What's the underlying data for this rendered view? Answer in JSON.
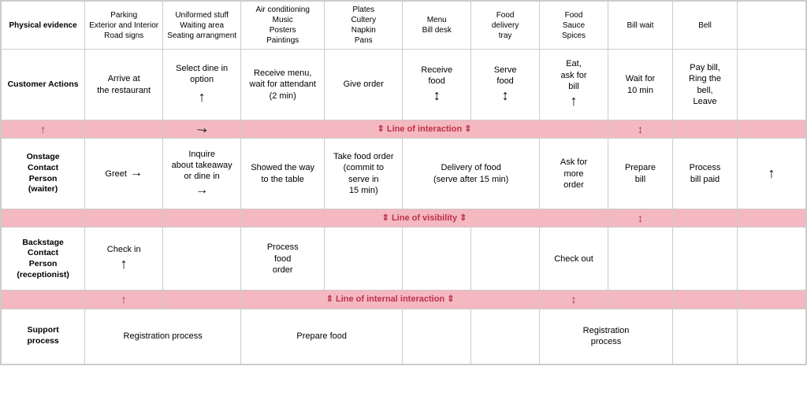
{
  "header": {
    "col0": "Physical evidence",
    "col1": "Parking\nExterior and Interior\nRoad signs",
    "col2": "Uniformed stuff\nWaiting area\nSeating arrangment",
    "col3": "Air conditioning\nMusic\nPosters\nPaintings",
    "col4": "Plates\nCultery\nNapkin\nPans",
    "col5": "Menu\nBill desk",
    "col6": "Food\ndelivery\ntray",
    "col7": "Food\nSauce\nSpices",
    "col8": "Bill wait",
    "col9": "Bell"
  },
  "customer": {
    "label": "Customer Actions",
    "col1": "Arrive at\nthe restaurant",
    "col2": "Select dine in\noption",
    "col3": "Receive menu,\nwait for attendant\n(2 min)",
    "col4": "Give order",
    "col5": "Receive\nfood",
    "col6": "Serve\nfood",
    "col7": "Eat,\nask for\nbill",
    "col8": "Wait for\n10 min",
    "col9": "Pay bill,\nRing the\nbell,\nLeave"
  },
  "divider1": {
    "label": "Line of interaction"
  },
  "onstage": {
    "label": "Onstage\nContact\nPerson\n(waiter)",
    "col1": "Greet",
    "col2": "Inquire\nabout takeaway\nor dine in",
    "col3": "Showed the way\nto the table",
    "col4": "Take food order\n(commit to\nserve in\n15 min)",
    "col5": "Delivery of food\n(serve after 15 min)",
    "col6": "",
    "col7": "Ask for\nmore\norder",
    "col8": "Prepare\nbill",
    "col9": "Process\nbill paid"
  },
  "divider2": {
    "label": "Line of visibility"
  },
  "backstage": {
    "label": "Backstage\nContact\nPerson\n(receptionist)",
    "col1": "Check in",
    "col2": "",
    "col3": "Process\nfood\norder",
    "col4": "",
    "col5": "",
    "col6": "",
    "col7": "Check out",
    "col8": "",
    "col9": ""
  },
  "divider3": {
    "label": "Line of internal interaction"
  },
  "support": {
    "label": "Support\nprocess",
    "col1": "Registration process",
    "col2": "",
    "col3": "Prepare food",
    "col4": "",
    "col5": "",
    "col6": "",
    "col7": "Registration\nprocess",
    "col8": "",
    "col9": ""
  }
}
